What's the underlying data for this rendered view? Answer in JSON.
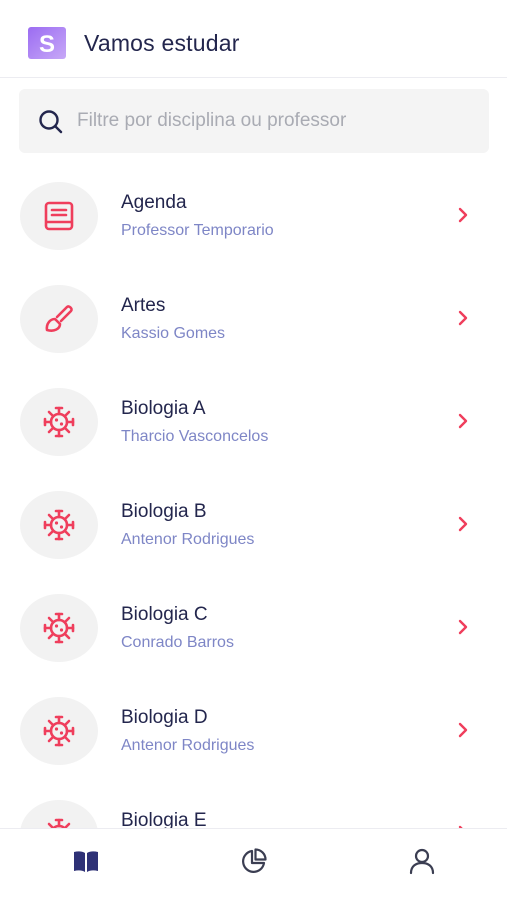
{
  "header": {
    "title": "Vamos estudar",
    "logo_letter": "S"
  },
  "search": {
    "placeholder": "Filtre por disciplina ou professor",
    "value": ""
  },
  "subjects": [
    {
      "title": "Agenda",
      "teacher": "Professor Temporario",
      "icon": "book-icon"
    },
    {
      "title": "Artes",
      "teacher": "Kassio Gomes",
      "icon": "paintbrush-icon"
    },
    {
      "title": "Biologia A",
      "teacher": "Tharcio Vasconcelos",
      "icon": "virus-icon"
    },
    {
      "title": "Biologia B",
      "teacher": "Antenor Rodrigues",
      "icon": "virus-icon"
    },
    {
      "title": "Biologia C",
      "teacher": "Conrado Barros",
      "icon": "virus-icon"
    },
    {
      "title": "Biologia D",
      "teacher": "Antenor Rodrigues",
      "icon": "virus-icon"
    },
    {
      "title": "Biologia E",
      "teacher": "",
      "icon": "virus-icon"
    }
  ],
  "bottom_nav": {
    "items": [
      {
        "icon": "open-book-icon",
        "active": true
      },
      {
        "icon": "pie-chart-icon",
        "active": false
      },
      {
        "icon": "profile-icon",
        "active": false
      }
    ]
  },
  "colors": {
    "accent": "#ef3e5c",
    "title_text": "#23264d",
    "subtitle_text": "#7e86c6",
    "nav_active": "#2e3176",
    "nav_inactive": "#3b3e52",
    "logo_gradient_start": "#8a5cf0",
    "logo_gradient_end": "#c9a4f5"
  }
}
